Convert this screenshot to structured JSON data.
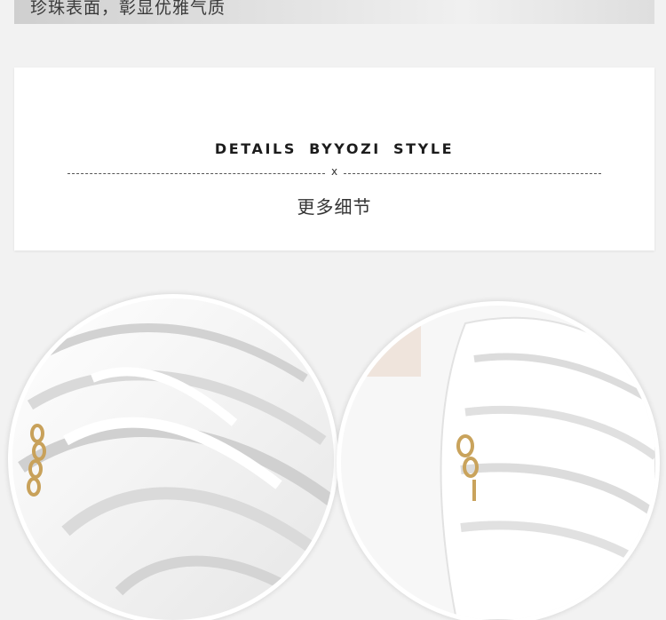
{
  "banner": {
    "text": "珍珠表面，彰显优雅气质"
  },
  "section": {
    "title": "DETAILS BYYOZI STYLE",
    "divider_mark": "x",
    "subtitle": "更多细节"
  },
  "images": [
    {
      "subject": "white pleated shell bag with gold chain clasp (close-up)"
    },
    {
      "subject": "white shell bag ridges with gold clasp (close-up)"
    }
  ]
}
